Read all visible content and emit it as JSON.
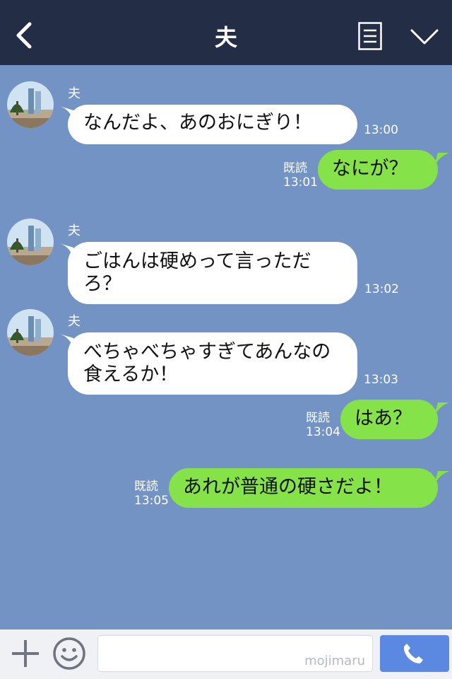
{
  "header": {
    "title": "夫",
    "icons": [
      "chevron-left-icon",
      "menu-list-icon",
      "chevron-down-icon"
    ]
  },
  "messages": [
    {
      "side": "in",
      "sender": "夫",
      "text": "なんだよ、あのおにぎり！",
      "time": "13:00"
    },
    {
      "side": "out",
      "read": "既読",
      "text": "なにが？",
      "time": "13:01"
    },
    {
      "side": "in",
      "sender": "夫",
      "text": "ごはんは硬めって言っただろ？",
      "time": "13:02"
    },
    {
      "side": "in",
      "sender": "夫",
      "text": "べちゃべちゃすぎてあんなの食えるか！",
      "time": "13:03"
    },
    {
      "side": "out",
      "read": "既読",
      "text": "はあ？",
      "time": "13:04"
    },
    {
      "side": "out",
      "read": "既読",
      "text": "あれが普通の硬さだよ！",
      "time": "13:05"
    }
  ],
  "footer": {
    "watermark": "mojimaru",
    "icons": [
      "plus-icon",
      "emoji-icon",
      "phone-icon"
    ]
  },
  "colors": {
    "header_bg": "#232d45",
    "chat_bg": "#7293c3",
    "outgoing_bubble": "#85e249",
    "incoming_bubble": "#ffffff",
    "call_button": "#5b88e0"
  }
}
